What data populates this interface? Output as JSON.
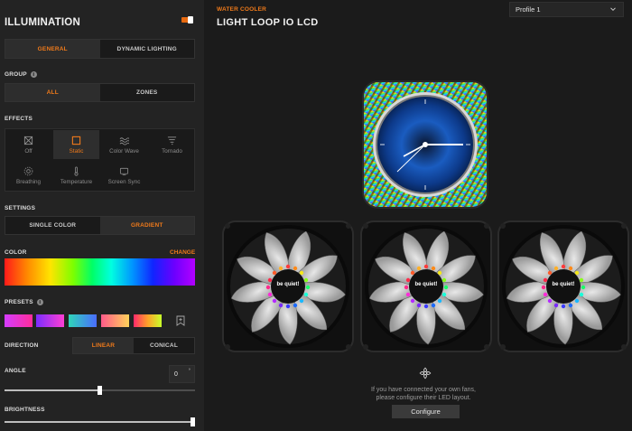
{
  "sidebar": {
    "title": "ILLUMINATION",
    "tabs": [
      {
        "label": "GENERAL",
        "active": true
      },
      {
        "label": "DYNAMIC LIGHTING",
        "active": false
      }
    ],
    "group": {
      "label": "GROUP",
      "options": [
        {
          "label": "ALL",
          "active": true
        },
        {
          "label": "ZONES",
          "active": false
        }
      ]
    },
    "effects": {
      "label": "EFFECTS",
      "items": [
        {
          "label": "Off",
          "icon": "off-icon",
          "active": false
        },
        {
          "label": "Static",
          "icon": "static-icon",
          "active": true
        },
        {
          "label": "Color Wave",
          "icon": "color-wave-icon",
          "active": false
        },
        {
          "label": "Tornado",
          "icon": "tornado-icon",
          "active": false
        },
        {
          "label": "Breathing",
          "icon": "breathing-icon",
          "active": false
        },
        {
          "label": "Temperature",
          "icon": "temperature-icon",
          "active": false
        },
        {
          "label": "Screen Sync",
          "icon": "screen-sync-icon",
          "active": false
        }
      ]
    },
    "settings": {
      "label": "SETTINGS",
      "options": [
        {
          "label": "SINGLE COLOR",
          "active": false
        },
        {
          "label": "GRADIENT",
          "active": true
        }
      ]
    },
    "color": {
      "label": "COLOR",
      "change_label": "CHANGE"
    },
    "presets": {
      "label": "PRESETS",
      "gradients": [
        [
          "#d43cff",
          "#ff2d9a"
        ],
        [
          "#7a2cff",
          "#ff3fd2"
        ],
        [
          "#2fd6b8",
          "#4a6cff"
        ],
        [
          "#ff5a8a",
          "#ffd25a"
        ],
        [
          "#ff2a6a",
          "#ffa02a",
          "#c8ff2a"
        ]
      ]
    },
    "direction": {
      "label": "DIRECTION",
      "options": [
        {
          "label": "LINEAR",
          "active": true
        },
        {
          "label": "CONICAL",
          "active": false
        }
      ]
    },
    "angle": {
      "label": "ANGLE",
      "value": "0",
      "unit": "°",
      "slider_fraction": 0.5
    },
    "brightness": {
      "label": "BRIGHTNESS",
      "slider_fraction": 1.0
    }
  },
  "main": {
    "subtitle": "WATER COOLER",
    "title": "LIGHT LOOP IO LCD",
    "profile": "Profile 1",
    "fan_logo_text": "be quiet!",
    "hint_line1": "If you have connected your own fans,",
    "hint_line2": "please configure their LED layout.",
    "configure_label": "Configure"
  },
  "colors": {
    "accent": "#f07a1a",
    "sidebar_bg": "#232323",
    "main_bg": "#1b1b1b"
  }
}
